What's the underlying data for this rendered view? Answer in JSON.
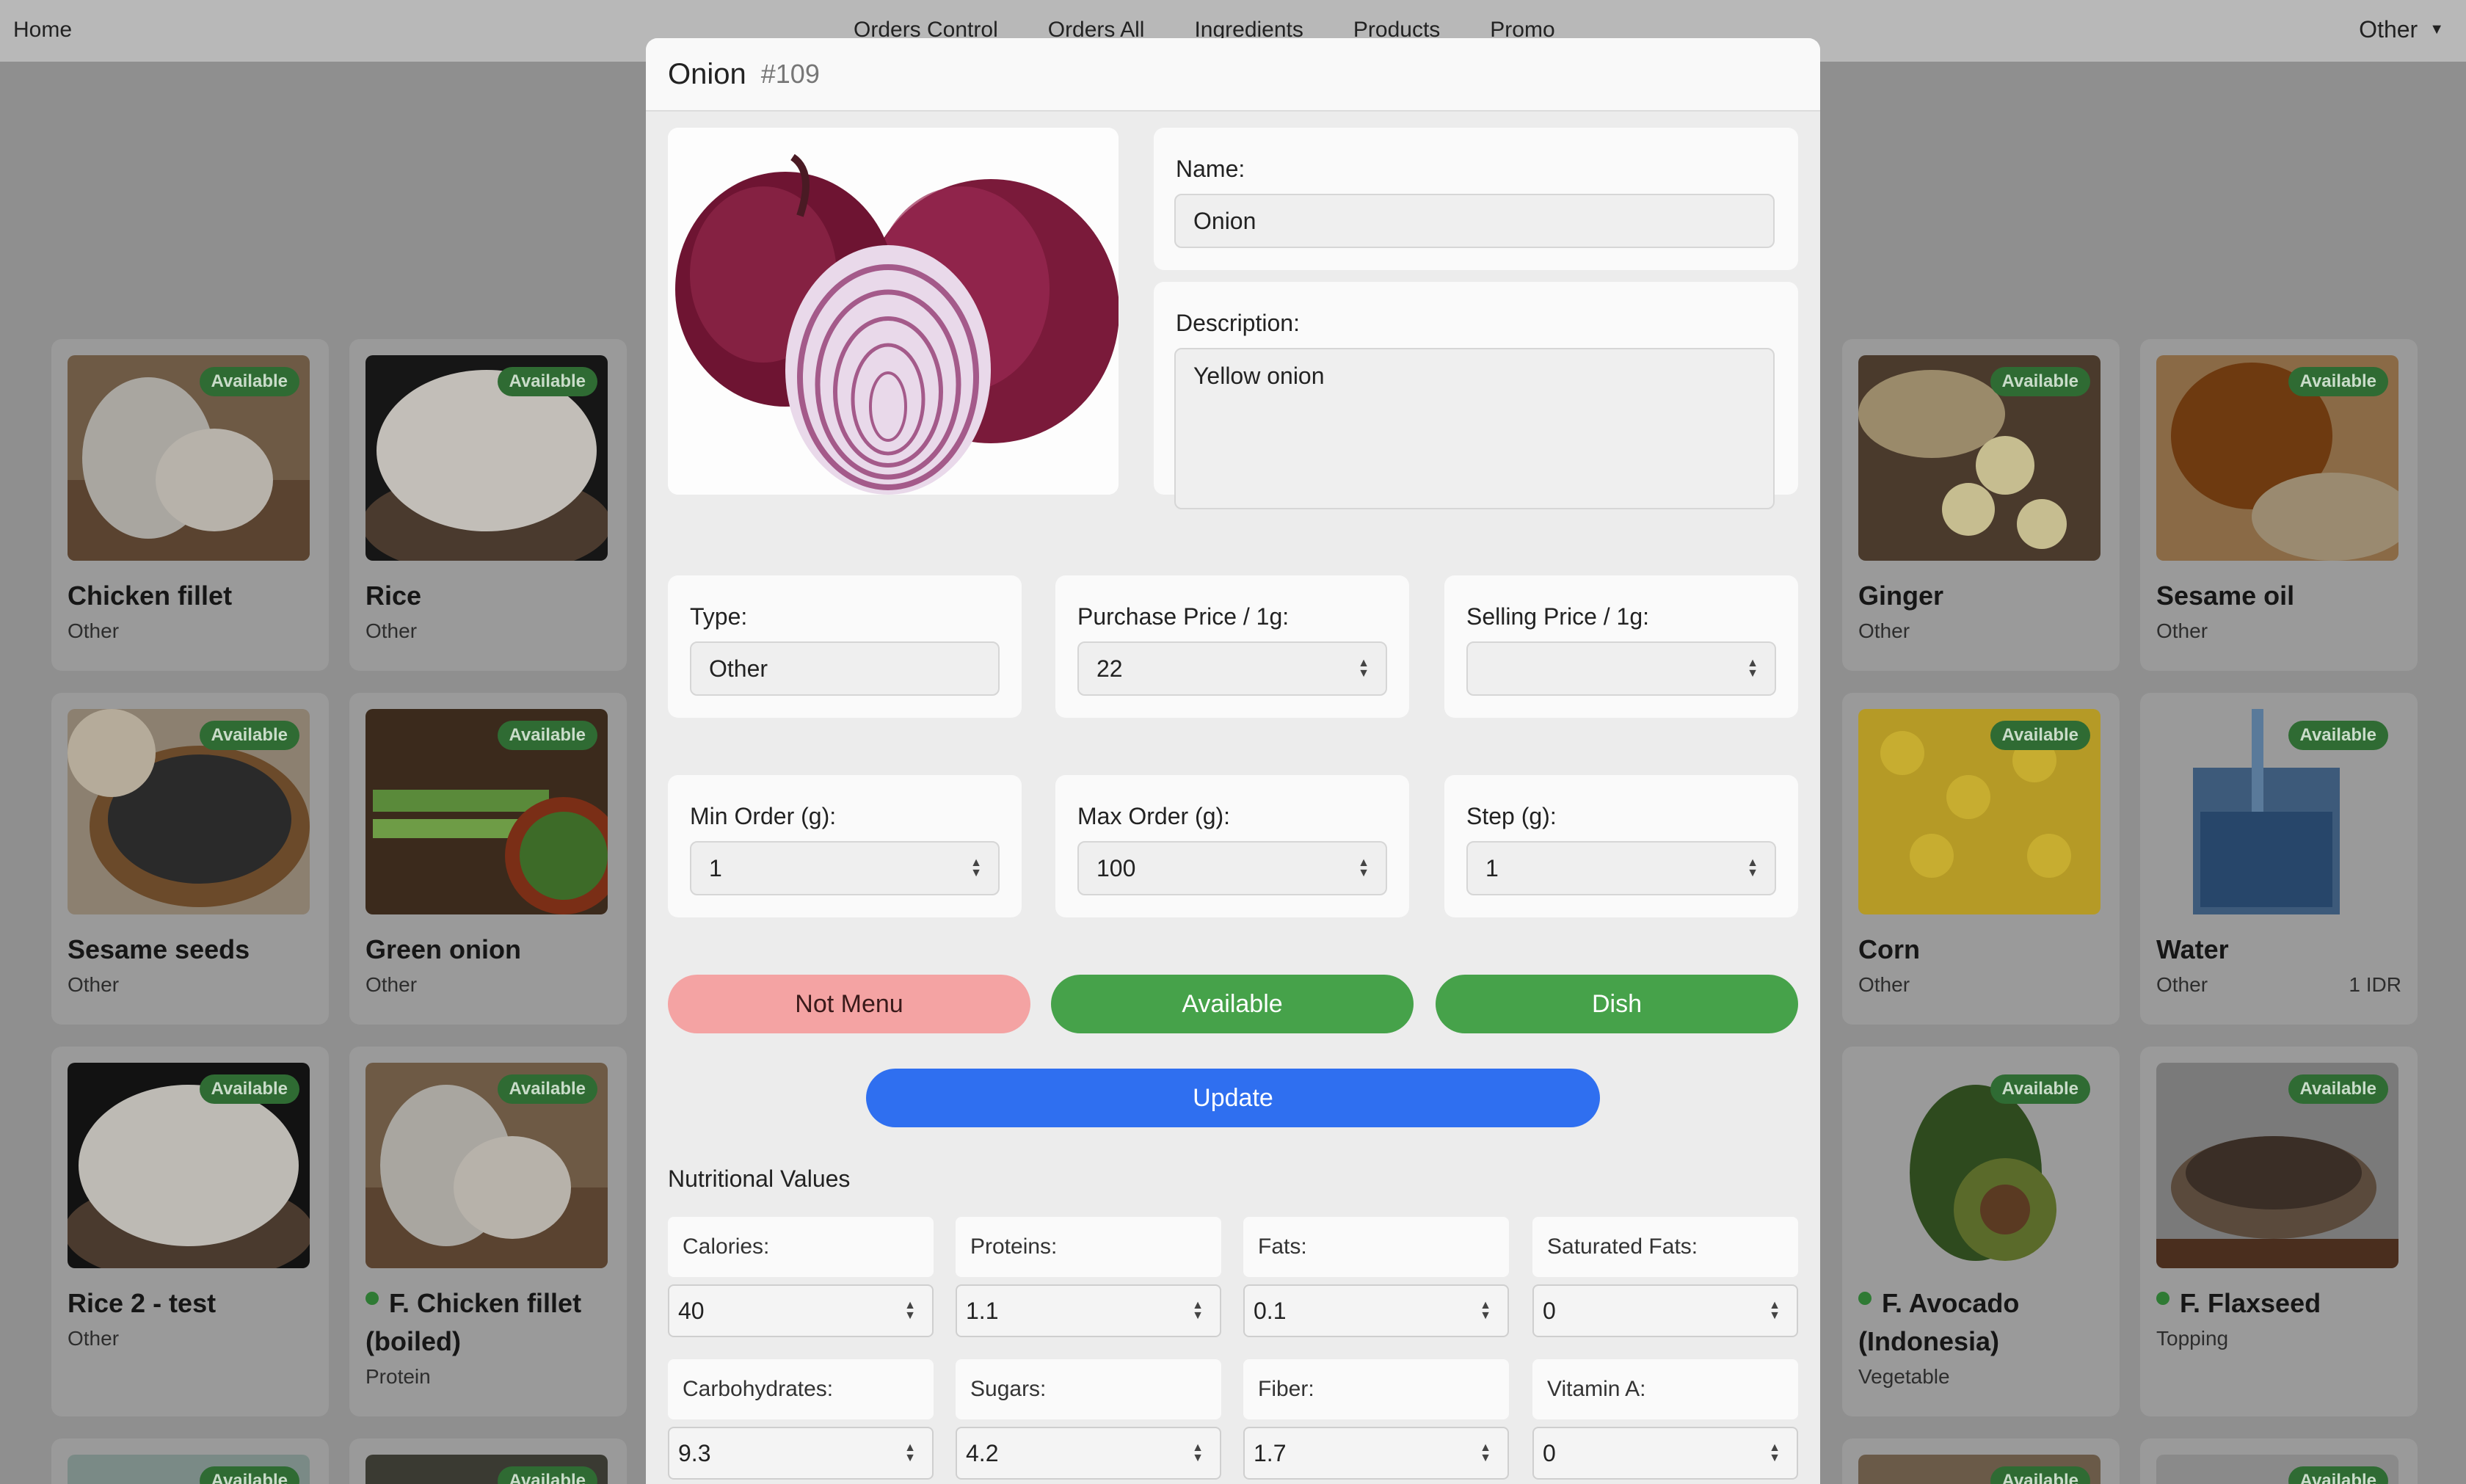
{
  "nav": {
    "home": "Home",
    "links": [
      "Orders Control",
      "Orders All",
      "Ingredients",
      "Products",
      "Promo"
    ],
    "other": "Other"
  },
  "cards": [
    {
      "name": "Chicken fillet",
      "type": "Other",
      "badge": "Available"
    },
    {
      "name": "Rice",
      "type": "Other",
      "badge": "Available"
    },
    {
      "name": "Sesame seeds",
      "type": "Other",
      "badge": "Available"
    },
    {
      "name": "Green onion",
      "type": "Other",
      "badge": "Available"
    },
    {
      "name": "Rice 2 - test",
      "type": "Other",
      "badge": "Available"
    },
    {
      "name": "F. Chicken fillet (boiled)",
      "type": "Protein",
      "badge": "Available"
    },
    {
      "name": "Ginger",
      "type": "Other",
      "badge": "Available"
    },
    {
      "name": "Sesame oil",
      "type": "Other",
      "badge": "Available"
    },
    {
      "name": "Corn",
      "type": "Other",
      "badge": "Available"
    },
    {
      "name": "Water",
      "type": "Other",
      "badge": "Available",
      "price": "1 IDR"
    },
    {
      "name": "F. Avocado (Indonesia)",
      "type": "Vegetable",
      "badge": "Available"
    },
    {
      "name": "F. Flaxseed",
      "type": "Topping",
      "badge": "Available"
    },
    {
      "badge": "Available"
    },
    {
      "badge": "Available"
    },
    {
      "badge": "Available"
    },
    {
      "badge": "Available"
    }
  ],
  "modal": {
    "title": "Onion",
    "id": "#109",
    "name_label": "Name:",
    "name_value": "Onion",
    "description_label": "Description:",
    "description_value": "Yellow onion",
    "type_label": "Type:",
    "type_value": "Other",
    "purchase_label": "Purchase Price / 1g:",
    "purchase_value": "22",
    "selling_label": "Selling Price / 1g:",
    "selling_value": "",
    "min_label": "Min Order (g):",
    "min_value": "1",
    "max_label": "Max Order (g):",
    "max_value": "100",
    "step_label": "Step (g):",
    "step_value": "1",
    "btn_not_menu": "Not Menu",
    "btn_available": "Available",
    "btn_dish": "Dish",
    "btn_update": "Update",
    "nutrition_title": "Nutritional Values",
    "nutrition": [
      {
        "label": "Calories:",
        "value": "40"
      },
      {
        "label": "Proteins:",
        "value": "1.1"
      },
      {
        "label": "Fats:",
        "value": "0.1"
      },
      {
        "label": "Saturated Fats:",
        "value": "0"
      },
      {
        "label": "Carbohydrates:",
        "value": "9.3"
      },
      {
        "label": "Sugars:",
        "value": "4.2"
      },
      {
        "label": "Fiber:",
        "value": "1.7"
      },
      {
        "label": "Vitamin A:",
        "value": "0"
      }
    ]
  },
  "colors": {
    "not_menu": "#f4a3a3",
    "green": "#46a24a",
    "update": "#2f6ff0",
    "badge": "#2f6b33"
  }
}
